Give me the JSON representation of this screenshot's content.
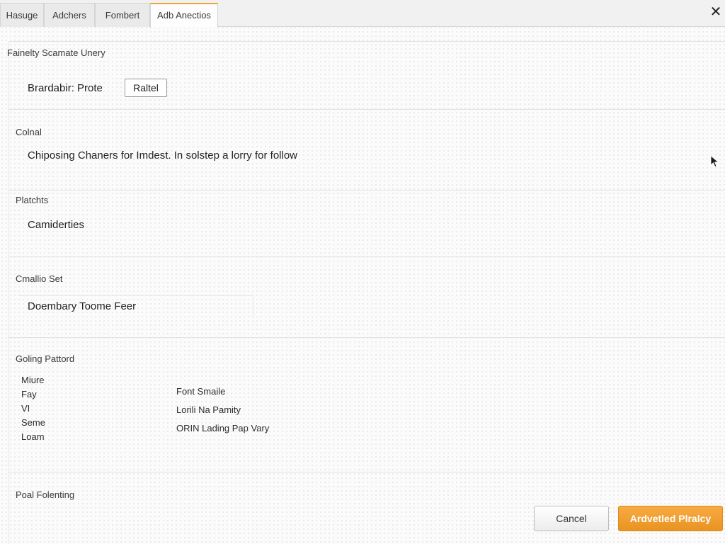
{
  "tabs": [
    {
      "label": "Hasuge"
    },
    {
      "label": "Adchers"
    },
    {
      "label": "Fombert"
    },
    {
      "label": "Adb Anectios"
    }
  ],
  "close_glyph": "✕",
  "sections": {
    "s1": {
      "title": "Fainelty Scamate Unery",
      "text": "Brardabir: Prote",
      "button_label": "Raltel"
    },
    "s2": {
      "title": "Colnal",
      "text": "Chiposing Chaners for Imdest. In solstep a lorry for follow"
    },
    "s3": {
      "title": "Platchts",
      "text": "Camiderties"
    },
    "s4": {
      "title": "Cmallio Set",
      "field_value": "Doembary Toome Feer"
    },
    "s5": {
      "title": "Goling Pattord",
      "left_items": [
        "Miure",
        "Fay",
        "VI",
        "Seme",
        "Loam"
      ],
      "right_items": [
        "Font Smaile",
        "Lorili Na Pamity",
        "ORIN Lading Pap Vary"
      ]
    },
    "s6": {
      "title": "Poal Folenting"
    }
  },
  "footer": {
    "cancel_label": "Cancel",
    "primary_label": "Ardvetled Plralcy"
  },
  "colors": {
    "accent": "#f0a23b",
    "primary_button": "#ef9a2c"
  },
  "icons": {
    "close": "close-icon",
    "cursor": "mouse-cursor-icon"
  }
}
